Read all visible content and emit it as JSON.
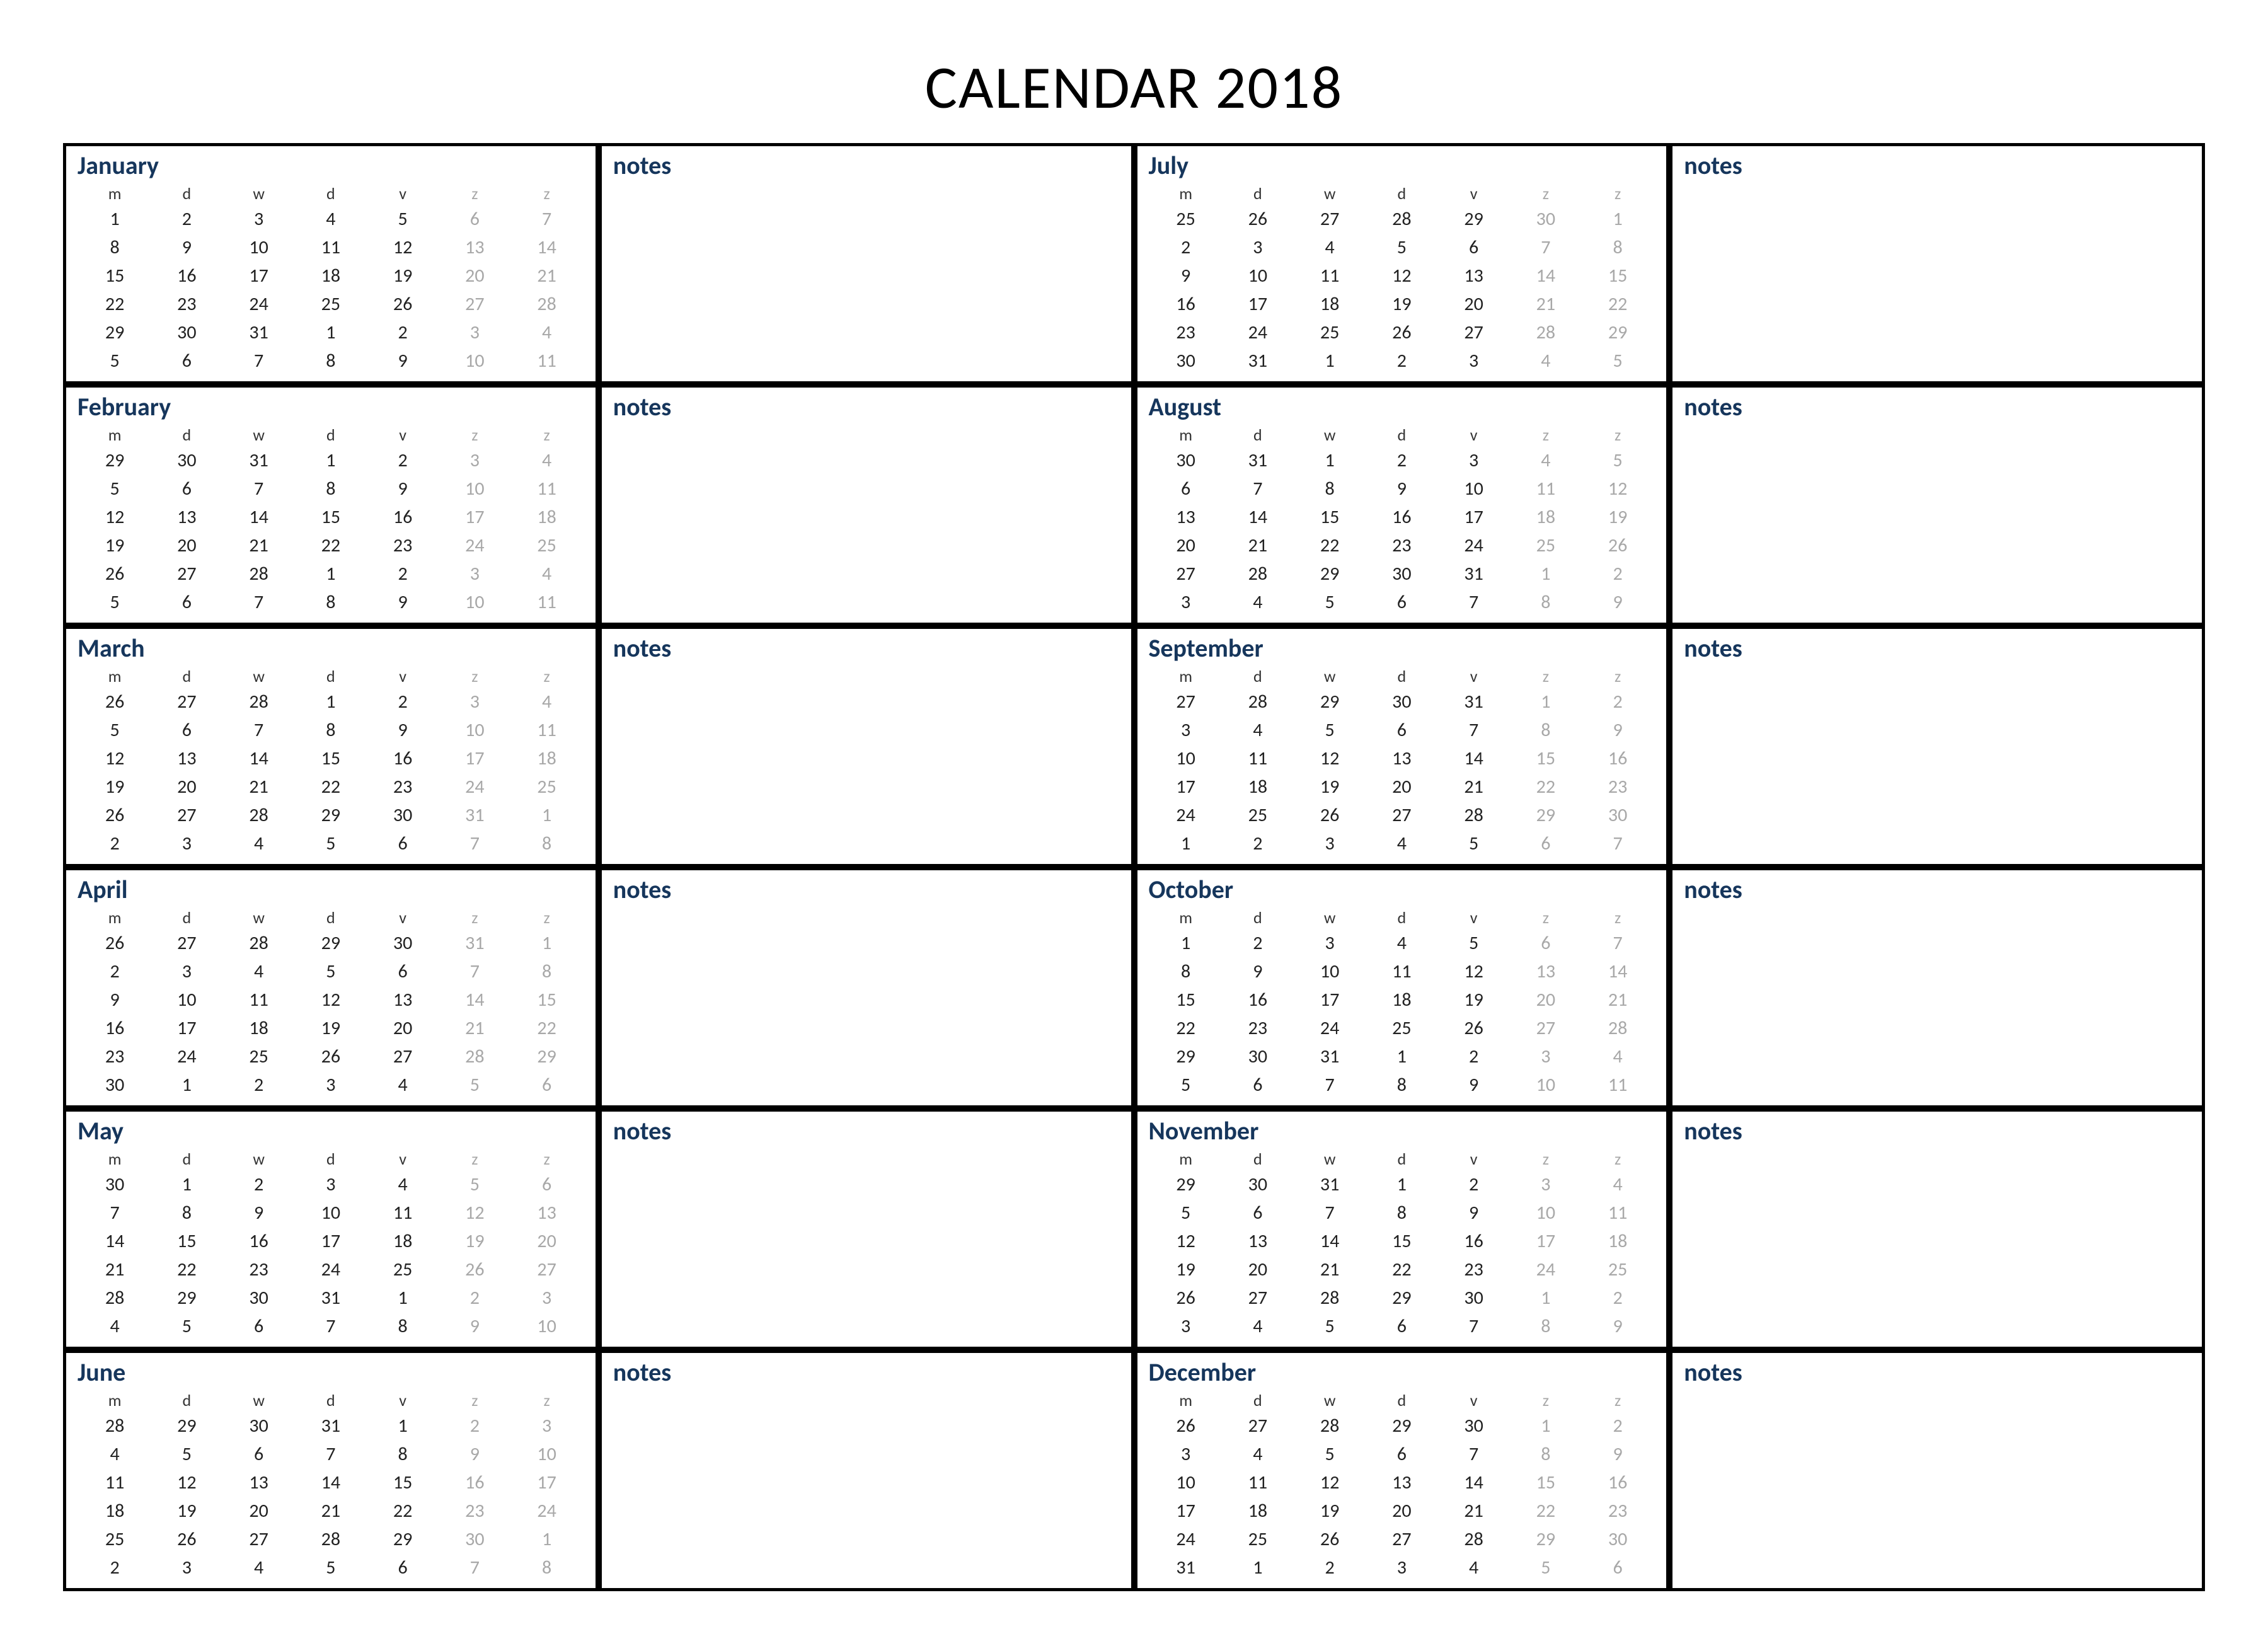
{
  "title": "CALENDAR 2018",
  "day_headers": [
    "m",
    "d",
    "w",
    "d",
    "v",
    "z",
    "z"
  ],
  "notes_label": "notes",
  "months": [
    {
      "name": "January",
      "weeks": [
        [
          1,
          2,
          3,
          4,
          5,
          6,
          7
        ],
        [
          8,
          9,
          10,
          11,
          12,
          13,
          14
        ],
        [
          15,
          16,
          17,
          18,
          19,
          20,
          21
        ],
        [
          22,
          23,
          24,
          25,
          26,
          27,
          28
        ],
        [
          29,
          30,
          31,
          1,
          2,
          3,
          4
        ],
        [
          5,
          6,
          7,
          8,
          9,
          10,
          11
        ]
      ]
    },
    {
      "name": "February",
      "weeks": [
        [
          29,
          30,
          31,
          1,
          2,
          3,
          4
        ],
        [
          5,
          6,
          7,
          8,
          9,
          10,
          11
        ],
        [
          12,
          13,
          14,
          15,
          16,
          17,
          18
        ],
        [
          19,
          20,
          21,
          22,
          23,
          24,
          25
        ],
        [
          26,
          27,
          28,
          1,
          2,
          3,
          4
        ],
        [
          5,
          6,
          7,
          8,
          9,
          10,
          11
        ]
      ]
    },
    {
      "name": "March",
      "weeks": [
        [
          26,
          27,
          28,
          1,
          2,
          3,
          4
        ],
        [
          5,
          6,
          7,
          8,
          9,
          10,
          11
        ],
        [
          12,
          13,
          14,
          15,
          16,
          17,
          18
        ],
        [
          19,
          20,
          21,
          22,
          23,
          24,
          25
        ],
        [
          26,
          27,
          28,
          29,
          30,
          31,
          1
        ],
        [
          2,
          3,
          4,
          5,
          6,
          7,
          8
        ]
      ]
    },
    {
      "name": "April",
      "weeks": [
        [
          26,
          27,
          28,
          29,
          30,
          31,
          1
        ],
        [
          2,
          3,
          4,
          5,
          6,
          7,
          8
        ],
        [
          9,
          10,
          11,
          12,
          13,
          14,
          15
        ],
        [
          16,
          17,
          18,
          19,
          20,
          21,
          22
        ],
        [
          23,
          24,
          25,
          26,
          27,
          28,
          29
        ],
        [
          30,
          1,
          2,
          3,
          4,
          5,
          6
        ]
      ]
    },
    {
      "name": "May",
      "weeks": [
        [
          30,
          1,
          2,
          3,
          4,
          5,
          6
        ],
        [
          7,
          8,
          9,
          10,
          11,
          12,
          13
        ],
        [
          14,
          15,
          16,
          17,
          18,
          19,
          20
        ],
        [
          21,
          22,
          23,
          24,
          25,
          26,
          27
        ],
        [
          28,
          29,
          30,
          31,
          1,
          2,
          3
        ],
        [
          4,
          5,
          6,
          7,
          8,
          9,
          10
        ]
      ]
    },
    {
      "name": "June",
      "weeks": [
        [
          28,
          29,
          30,
          31,
          1,
          2,
          3
        ],
        [
          4,
          5,
          6,
          7,
          8,
          9,
          10
        ],
        [
          11,
          12,
          13,
          14,
          15,
          16,
          17
        ],
        [
          18,
          19,
          20,
          21,
          22,
          23,
          24
        ],
        [
          25,
          26,
          27,
          28,
          29,
          30,
          1
        ],
        [
          2,
          3,
          4,
          5,
          6,
          7,
          8
        ]
      ]
    },
    {
      "name": "July",
      "weeks": [
        [
          25,
          26,
          27,
          28,
          29,
          30,
          1
        ],
        [
          2,
          3,
          4,
          5,
          6,
          7,
          8
        ],
        [
          9,
          10,
          11,
          12,
          13,
          14,
          15
        ],
        [
          16,
          17,
          18,
          19,
          20,
          21,
          22
        ],
        [
          23,
          24,
          25,
          26,
          27,
          28,
          29
        ],
        [
          30,
          31,
          1,
          2,
          3,
          4,
          5
        ]
      ]
    },
    {
      "name": "August",
      "weeks": [
        [
          30,
          31,
          1,
          2,
          3,
          4,
          5
        ],
        [
          6,
          7,
          8,
          9,
          10,
          11,
          12
        ],
        [
          13,
          14,
          15,
          16,
          17,
          18,
          19
        ],
        [
          20,
          21,
          22,
          23,
          24,
          25,
          26
        ],
        [
          27,
          28,
          29,
          30,
          31,
          1,
          2
        ],
        [
          3,
          4,
          5,
          6,
          7,
          8,
          9
        ]
      ]
    },
    {
      "name": "September",
      "weeks": [
        [
          27,
          28,
          29,
          30,
          31,
          1,
          2
        ],
        [
          3,
          4,
          5,
          6,
          7,
          8,
          9
        ],
        [
          10,
          11,
          12,
          13,
          14,
          15,
          16
        ],
        [
          17,
          18,
          19,
          20,
          21,
          22,
          23
        ],
        [
          24,
          25,
          26,
          27,
          28,
          29,
          30
        ],
        [
          1,
          2,
          3,
          4,
          5,
          6,
          7
        ]
      ]
    },
    {
      "name": "October",
      "weeks": [
        [
          1,
          2,
          3,
          4,
          5,
          6,
          7
        ],
        [
          8,
          9,
          10,
          11,
          12,
          13,
          14
        ],
        [
          15,
          16,
          17,
          18,
          19,
          20,
          21
        ],
        [
          22,
          23,
          24,
          25,
          26,
          27,
          28
        ],
        [
          29,
          30,
          31,
          1,
          2,
          3,
          4
        ],
        [
          5,
          6,
          7,
          8,
          9,
          10,
          11
        ]
      ]
    },
    {
      "name": "November",
      "weeks": [
        [
          29,
          30,
          31,
          1,
          2,
          3,
          4
        ],
        [
          5,
          6,
          7,
          8,
          9,
          10,
          11
        ],
        [
          12,
          13,
          14,
          15,
          16,
          17,
          18
        ],
        [
          19,
          20,
          21,
          22,
          23,
          24,
          25
        ],
        [
          26,
          27,
          28,
          29,
          30,
          1,
          2
        ],
        [
          3,
          4,
          5,
          6,
          7,
          8,
          9
        ]
      ]
    },
    {
      "name": "December",
      "weeks": [
        [
          26,
          27,
          28,
          29,
          30,
          1,
          2
        ],
        [
          3,
          4,
          5,
          6,
          7,
          8,
          9
        ],
        [
          10,
          11,
          12,
          13,
          14,
          15,
          16
        ],
        [
          17,
          18,
          19,
          20,
          21,
          22,
          23
        ],
        [
          24,
          25,
          26,
          27,
          28,
          29,
          30
        ],
        [
          31,
          1,
          2,
          3,
          4,
          5,
          6
        ]
      ]
    }
  ]
}
